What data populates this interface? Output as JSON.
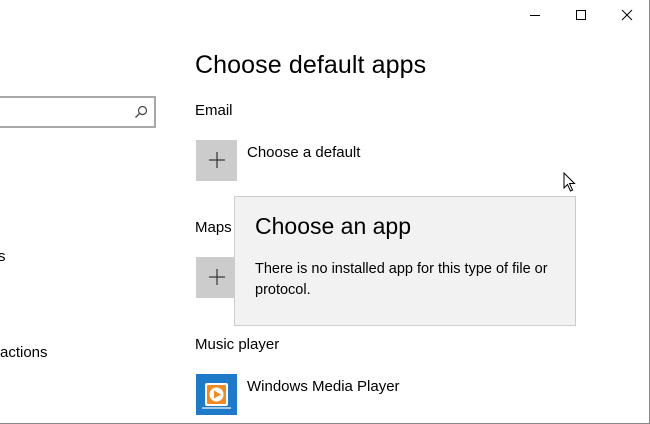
{
  "window": {
    "controls": {
      "minimize": "minimize-icon",
      "maximize": "maximize-icon",
      "close": "close-icon"
    }
  },
  "sidebar": {
    "search": {
      "value": "",
      "placeholder": "",
      "icon": "search-icon"
    },
    "fragments": [
      "s",
      "actions"
    ]
  },
  "main": {
    "title": "Choose default apps",
    "sections": [
      {
        "label": "Email",
        "app": "Choose a default",
        "icon": "plus-icon"
      },
      {
        "label": "Maps",
        "app": "",
        "icon": "plus-icon"
      },
      {
        "label": "Music player",
        "app": "Windows Media Player",
        "icon": "windows-media-player-icon"
      }
    ]
  },
  "flyout": {
    "title": "Choose an app",
    "text": "There is no installed app for this type of file or protocol."
  },
  "colors": {
    "tile_gray": "#cccccc",
    "flyout_bg": "#f2f2f2",
    "wmp_blue": "#1f79c9",
    "wmp_orange": "#f08a24"
  }
}
